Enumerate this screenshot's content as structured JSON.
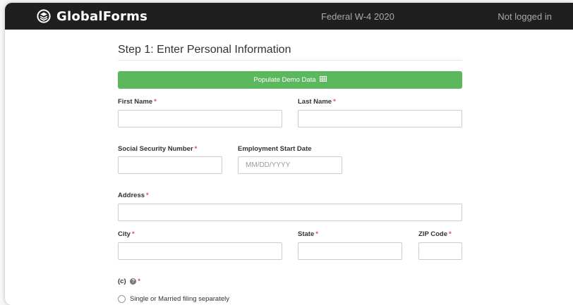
{
  "header": {
    "brand": "GlobalForms",
    "form_title": "Federal W-4 2020",
    "login_status": "Not logged in"
  },
  "step": {
    "title": "Step 1: Enter Personal Information"
  },
  "demo_button": {
    "label": "Populate Demo Data",
    "icon": "table-icon"
  },
  "fields": {
    "first_name": {
      "label": "First Name",
      "required_mark": "*",
      "value": ""
    },
    "last_name": {
      "label": "Last Name",
      "required_mark": "*",
      "value": ""
    },
    "ssn": {
      "label": "Social Security Number",
      "required_mark": "*",
      "value": ""
    },
    "start_date": {
      "label": "Employment Start Date",
      "placeholder": "MM/DD/YYYY",
      "value": ""
    },
    "address": {
      "label": "Address",
      "required_mark": "*",
      "value": ""
    },
    "city": {
      "label": "City",
      "required_mark": "*",
      "value": ""
    },
    "state": {
      "label": "State",
      "required_mark": "*",
      "value": ""
    },
    "zip": {
      "label": "ZIP Code",
      "required_mark": "*",
      "value": ""
    }
  },
  "filing_status": {
    "label": "(c)",
    "required_mark": "*",
    "help_icon": "question-circle-icon",
    "options": [
      {
        "label": "Single or Married filing separately",
        "selected": false
      }
    ]
  },
  "colors": {
    "topbar": "#1f1f1f",
    "button_green": "#5cb85c",
    "required_red": "#d9534f"
  }
}
